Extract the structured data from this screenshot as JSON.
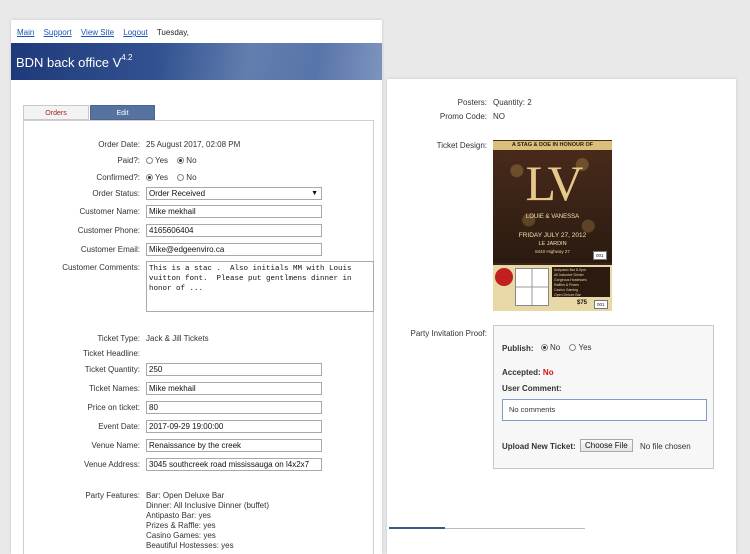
{
  "nav": {
    "main": "Main",
    "support": "Support",
    "view_site": "View Site",
    "logout": "Logout",
    "day": "Tuesday,"
  },
  "banner": {
    "title": "BDN back office V",
    "version": "4.2"
  },
  "tabs": {
    "orders": "Orders",
    "edit": "Edit"
  },
  "order": {
    "order_date_label": "Order Date:",
    "order_date": "25 August 2017, 02:08 PM",
    "paid_label": "Paid?:",
    "paid_yes": "Yes",
    "paid_no": "No",
    "confirmed_label": "Confirmed?:",
    "confirmed_yes": "Yes",
    "confirmed_no": "No",
    "status_label": "Order Status:",
    "status": "Order Received",
    "name_label": "Customer Name:",
    "name": "Mike mekhail",
    "phone_label": "Customer Phone:",
    "phone": "4165606404",
    "email_label": "Customer Email:",
    "email": "Mike@edgeenviro.ca",
    "comments_label": "Customer Comments:",
    "comments": "This is a stac .  Also initials MM with Louis vuitton font.  Please put gentlmens dinner in honor of ...",
    "ticket_type_label": "Ticket Type:",
    "ticket_type": "Jack & Jill Tickets",
    "ticket_headline_label": "Ticket Headline:",
    "quantity_label": "Ticket Quantity:",
    "quantity": "250",
    "ticket_names_label": "Ticket Names:",
    "ticket_names": "Mike mekhail",
    "price_label": "Price on ticket:",
    "price": "80",
    "event_date_label": "Event Date:",
    "event_date": "2017-09-29 19:00:00",
    "venue_name_label": "Venue Name:",
    "venue_name": "Renaissance by the creek",
    "venue_address_label": "Venue Address:",
    "venue_address": "3045 southcreek road mississauga on l4x2x7",
    "features_label": "Party Features:",
    "features": [
      "Bar: Open Deluxe Bar",
      "Dinner: All Inclusive Dinner (buffet)",
      "Antipasto Bar: yes",
      "Prizes & Raffle: yes",
      "Casino Games: yes",
      "Beautiful Hostesses: yes"
    ]
  },
  "right": {
    "posters_label": "Posters:",
    "posters": "Quantity: 2",
    "promo_label": "Promo Code:",
    "promo": "NO",
    "design_label": "Ticket Design:",
    "ticket": {
      "banner": "A STAG & DOE IN HONOUR OF",
      "logo": "LV",
      "names": "LOUIE & VANESSA",
      "date": "FRIDAY JULY 27, 2012",
      "venue": "LE JARDIN",
      "address": "8440 Highway 27",
      "number": "001",
      "list": [
        "Antipasto Bar 8-9pm",
        "All Inclusive Dinner",
        "Gorgeous Hostesses",
        "Raffles & Prizes",
        "Casino Gaming",
        "Open Deluxe Bar"
      ],
      "price": "$75"
    },
    "proof_label": "Party Invitation Proof:",
    "publish_label": "Publish:",
    "publish_no": "No",
    "publish_yes": "Yes",
    "accepted_label": "Accepted:",
    "accepted": "No",
    "user_comment_label": "User Comment:",
    "comment": "No comments",
    "upload_label": "Upload New Ticket:",
    "choose_file": "Choose File",
    "no_file": "No file chosen"
  }
}
